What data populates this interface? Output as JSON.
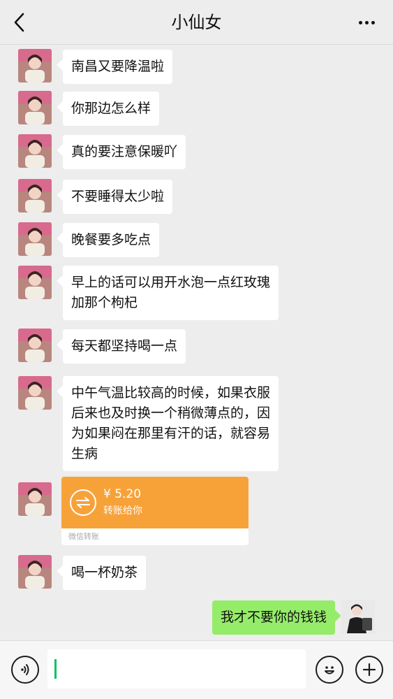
{
  "header": {
    "title": "小仙女",
    "back_icon": "chevron-left-icon",
    "more_icon": "more-icon"
  },
  "messages": [
    {
      "sender": "contact",
      "type": "text",
      "text": "南昌又要降温啦"
    },
    {
      "sender": "contact",
      "type": "text",
      "text": "你那边怎么样"
    },
    {
      "sender": "contact",
      "type": "text",
      "text": "真的要注意保暖吖"
    },
    {
      "sender": "contact",
      "type": "text",
      "text": "不要睡得太少啦"
    },
    {
      "sender": "contact",
      "type": "text",
      "text": "晚餐要多吃点"
    },
    {
      "sender": "contact",
      "type": "text",
      "lines": [
        "早上的话可以用开水泡一点红玫瑰",
        "加那个枸杞"
      ]
    },
    {
      "sender": "contact",
      "type": "text",
      "text": "每天都坚持喝一点"
    },
    {
      "sender": "contact",
      "type": "text",
      "lines": [
        "中午气温比较高的时候，如果衣服",
        "后来也及时换一个稍微薄点的，因",
        "为如果闷在那里有汗的话，就容易",
        "生病"
      ]
    },
    {
      "sender": "contact",
      "type": "transfer",
      "amount": "¥ 5.20",
      "note": "转账给你",
      "footer": "微信转账"
    },
    {
      "sender": "contact",
      "type": "text",
      "text": "喝一杯奶茶"
    },
    {
      "sender": "me",
      "type": "text",
      "text": "我才不要你的钱钱"
    }
  ],
  "input_bar": {
    "voice_icon": "voice-icon",
    "emoji_icon": "emoji-icon",
    "plus_icon": "plus-icon",
    "text_value": ""
  },
  "colors": {
    "background": "#ededed",
    "outgoing_bubble": "#95ec69",
    "incoming_bubble": "#ffffff",
    "transfer": "#f7a239",
    "cursor": "#07c160"
  }
}
